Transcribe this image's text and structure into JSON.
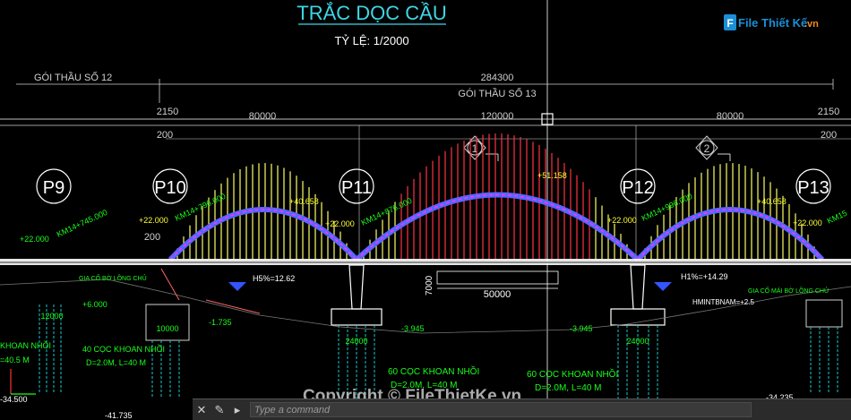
{
  "drawing": {
    "title": "TRẮC DỌC CẦU",
    "scale": "TỶ LỆ: 1/2000",
    "package_12": "GÓI THẦU SỐ 12",
    "package_13": "GÓI THẦU SỐ 13",
    "total_length": "284300",
    "dim_2150_left": "2150",
    "dim_2150_right": "2150",
    "span_80000_left": "80000",
    "span_120000": "120000",
    "span_80000_right": "80000",
    "dim_200_a": "200",
    "dim_200_b": "200",
    "dim_200_c": "200",
    "section_1": "1",
    "section_2": "2",
    "piers": [
      "P9",
      "P10",
      "P11",
      "P12",
      "P13"
    ],
    "top_elev": "+51.158",
    "arch_elev_left": "+40.658",
    "arch_elev_right": "+40.658",
    "elev_p9": "+22.000",
    "elev_p10": "+22.000",
    "elev_p11": "+22.000",
    "elev_p12": "+22.000",
    "elev_p13": "+22.000",
    "km_p9": "KM14+745.000",
    "km_p10": "KM14+796.000",
    "km_p11": "KM14+876.000",
    "km_p12": "KM14+996.000",
    "km_p13": "KM15",
    "slope_left": "H5%=12.62",
    "slope_right": "H1%=+14.29",
    "support_left": "GIA CỐ BỜ LỒNG CHỦ",
    "support_right": "GIA CỐ MÁI BỜ LỒNG CHỦ",
    "hmin": "HMINTBNAM=+2.5",
    "clear_height": "7000",
    "clear_width": "50000",
    "elev_plus6": "+6.000",
    "elev_m1735": "-1.735",
    "elev_m3945_l": "-3.945",
    "elev_m3945_r": "-3.945",
    "dim_12000": "12000",
    "dim_10000": "10000",
    "dim_24000_l": "24000",
    "dim_24000_r": "24000",
    "pile_p10_a": "40 CỌC KHOAN NHỒI",
    "pile_p10_b": "D=2.0M, L=40 M",
    "pile_mid_a": "60 CỌC KHOAN NHỒI",
    "pile_mid_b": "D=2.0M, L=40 M",
    "pile_right_a": "60 CỌC KHOAN NHỒI",
    "pile_right_b": "D=2.0M, L=40 M",
    "pile_p9_a": "KHOAN NHỒI",
    "pile_p9_b": "=40.5 M",
    "elev_m34235": "-34.235",
    "elev_m34500": "-34.500",
    "elev_m41735": "-41.735",
    "logo_text": "File Thiết Kế",
    "logo_suffix": ".vn",
    "watermark": "Copyright © FileThietKe.vn"
  },
  "command_line": {
    "placeholder": "Type a command"
  },
  "colors": {
    "cyan": "#3fd6e6",
    "green": "#19ff19",
    "white": "#ffffff",
    "yellow": "#ffff33",
    "red": "#ff3333",
    "magenta": "#ff33ff",
    "blue": "#3355ff"
  }
}
